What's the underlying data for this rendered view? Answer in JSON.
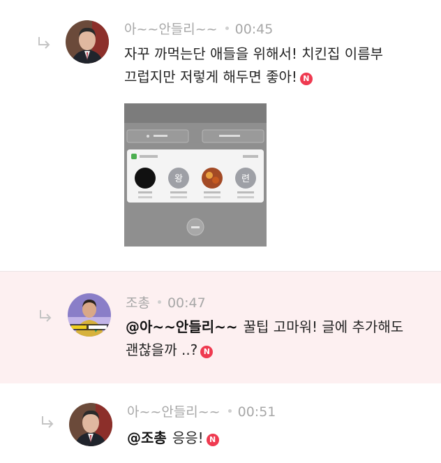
{
  "comments": [
    {
      "author": "아~~안들리~~",
      "time": "00:45",
      "lines": [
        "자꾸 까먹는단 애들을 위해서! 치킨집 이름부",
        "끄럽지만 저렇게 해두면 좋아!"
      ],
      "new_badge": "N"
    },
    {
      "author": "조총",
      "time": "00:47",
      "mention": "@아~~안들리~~",
      "line1": "꿀팁 고마워! 글에 추가해도",
      "line2": "괜찮을까 ..?",
      "new_badge": "N"
    },
    {
      "author": "아~~안들리~~",
      "time": "00:51",
      "mention": "@조총",
      "text": "응응!",
      "new_badge": "N"
    }
  ],
  "colors": {
    "accent_badge": "#ef3a50",
    "highlight_bg": "#fdf0f1",
    "meta_text": "#a7a7a7"
  },
  "icons": {
    "reply": "reply-arrow-icon",
    "new": "new-badge-icon"
  }
}
